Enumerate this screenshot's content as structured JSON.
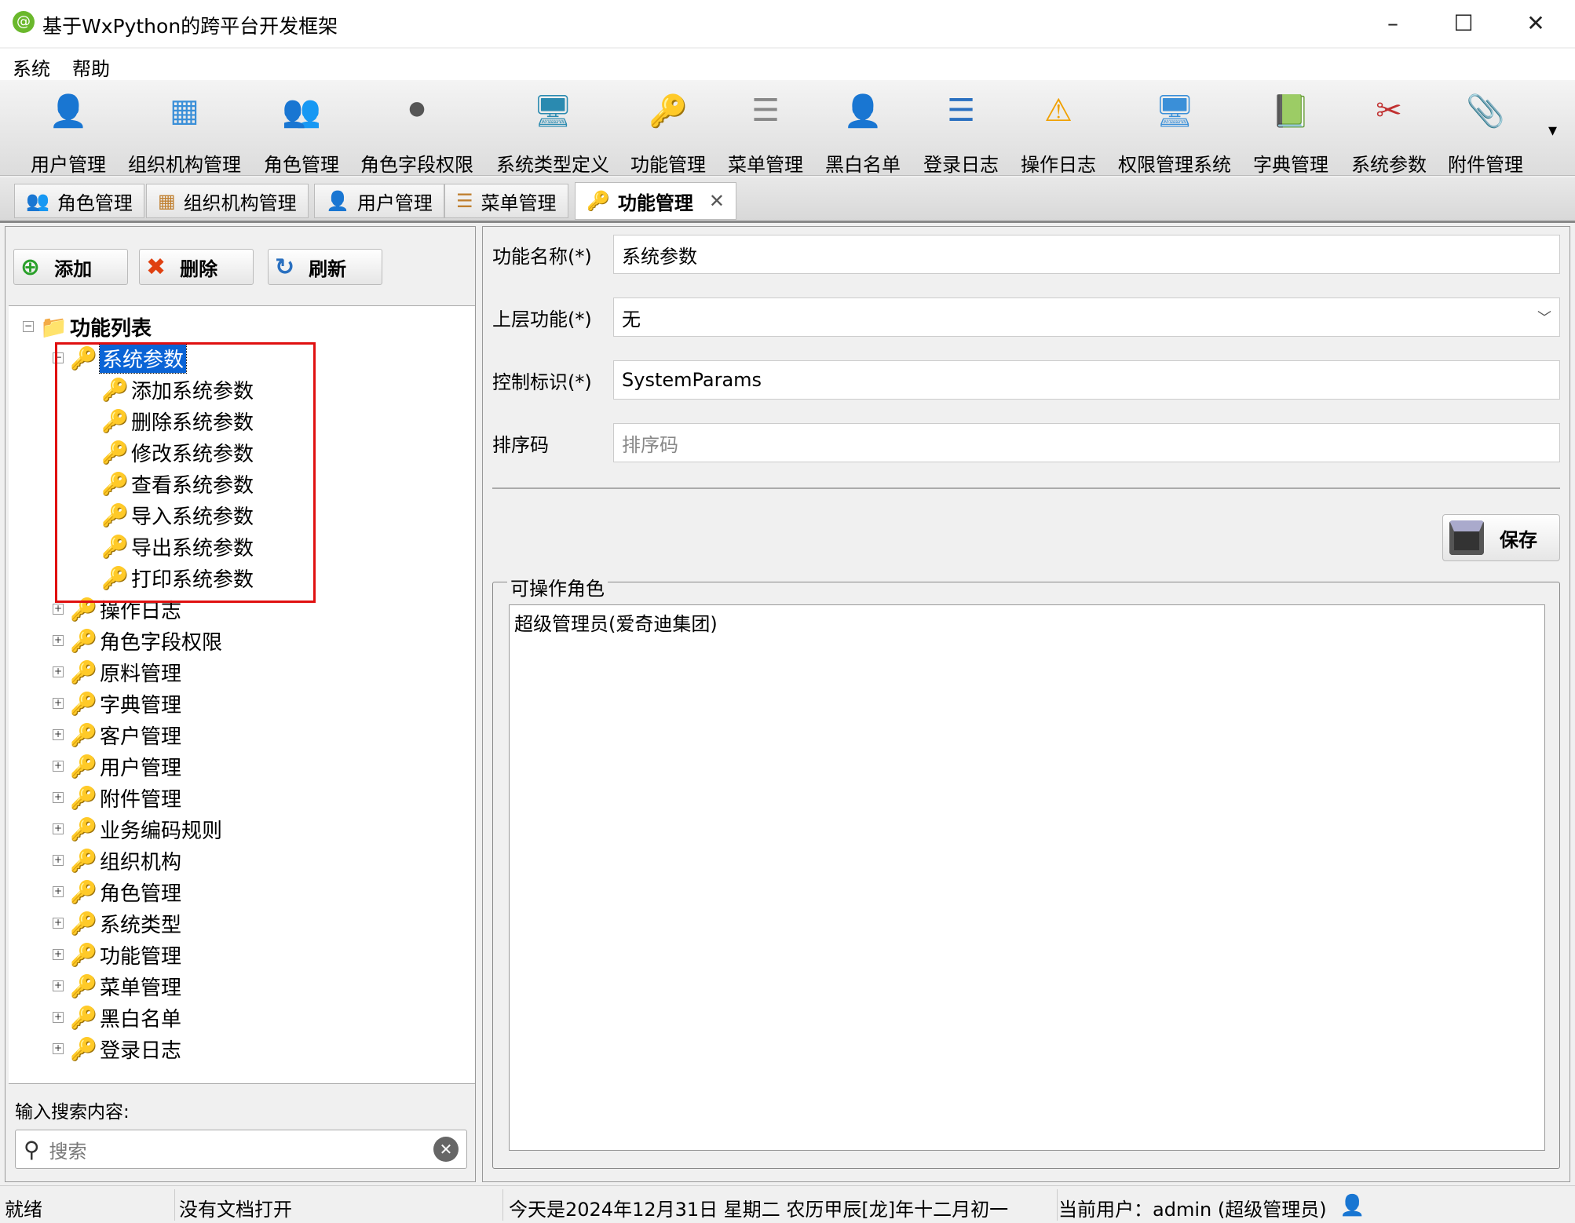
{
  "window": {
    "title": "基于WxPython的跨平台开发框架",
    "minimize": "–",
    "maximize": "☐",
    "close": "✕"
  },
  "menu": [
    "系统",
    "帮助"
  ],
  "toolbar": [
    {
      "label": "用户管理",
      "icon": "user-icon",
      "glyph": "👤",
      "color": "#8cc63f"
    },
    {
      "label": "组织机构管理",
      "icon": "org-chart-icon",
      "glyph": "▦",
      "color": "#3a8fd8"
    },
    {
      "label": "角色管理",
      "icon": "role-users-icon",
      "glyph": "👥",
      "color": "#c47a30"
    },
    {
      "label": "角色字段权限",
      "icon": "traffic-light-icon",
      "glyph": "⚫",
      "color": "#555"
    },
    {
      "label": "系统类型定义",
      "icon": "monitor-icon",
      "glyph": "🖥",
      "color": "#2a8ab0"
    },
    {
      "label": "功能管理",
      "icon": "key-icon",
      "glyph": "🔑",
      "color": "#e0a020"
    },
    {
      "label": "菜单管理",
      "icon": "menu-doc-icon",
      "glyph": "☰",
      "color": "#888"
    },
    {
      "label": "黑白名单",
      "icon": "person-black-icon",
      "glyph": "👤",
      "color": "#222"
    },
    {
      "label": "登录日志",
      "icon": "log-list-icon",
      "glyph": "☰",
      "color": "#2a70c0"
    },
    {
      "label": "操作日志",
      "icon": "warning-icon",
      "glyph": "⚠",
      "color": "#f0a000"
    },
    {
      "label": "权限管理系统",
      "icon": "computer-key-icon",
      "glyph": "🖥",
      "color": "#3a8fd8"
    },
    {
      "label": "字典管理",
      "icon": "book-icon",
      "glyph": "📗",
      "color": "#3a9a30"
    },
    {
      "label": "系统参数",
      "icon": "tools-icon",
      "glyph": "✂",
      "color": "#c03030"
    },
    {
      "label": "附件管理",
      "icon": "paperclip-icon",
      "glyph": "📎",
      "color": "#8899aa"
    }
  ],
  "toolbar_overflow": "▾",
  "tabs": [
    {
      "label": "角色管理",
      "glyph": "👥"
    },
    {
      "label": "组织机构管理",
      "glyph": "▦"
    },
    {
      "label": "用户管理",
      "glyph": "👤"
    },
    {
      "label": "菜单管理",
      "glyph": "☰"
    },
    {
      "label": "功能管理",
      "glyph": "🔑",
      "active": true
    }
  ],
  "tab_close": "✕",
  "left": {
    "buttons": [
      {
        "label": "添加",
        "glyph": "⊕",
        "color": "#2aa02a"
      },
      {
        "label": "删除",
        "glyph": "✖",
        "color": "#e04010"
      },
      {
        "label": "刷新",
        "glyph": "↻",
        "color": "#2a70c0"
      }
    ],
    "tree_root": "功能列表",
    "selected": "系统参数",
    "children": [
      "添加系统参数",
      "删除系统参数",
      "修改系统参数",
      "查看系统参数",
      "导入系统参数",
      "导出系统参数",
      "打印系统参数"
    ],
    "siblings": [
      "操作日志",
      "角色字段权限",
      "原料管理",
      "字典管理",
      "客户管理",
      "用户管理",
      "附件管理",
      "业务编码规则",
      "组织机构",
      "角色管理",
      "系统类型",
      "功能管理",
      "菜单管理",
      "黑白名单",
      "登录日志"
    ],
    "search_label": "输入搜索内容:",
    "search_placeholder": "搜索"
  },
  "form": {
    "name_label": "功能名称(*)",
    "name_value": "系统参数",
    "parent_label": "上层功能(*)",
    "parent_value": "无",
    "control_label": "控制标识(*)",
    "control_value": "SystemParams",
    "sort_label": "排序码",
    "sort_placeholder": "排序码",
    "save": "保存",
    "roles_title": "可操作角色",
    "roles": [
      "超级管理员(爱奇迪集团)"
    ]
  },
  "status": {
    "ready": "就绪",
    "doc": "没有文档打开",
    "date": "今天是2024年12月31日 星期二 农历甲辰[龙]年十二月初一",
    "user": "当前用户：admin (超级管理员)"
  }
}
